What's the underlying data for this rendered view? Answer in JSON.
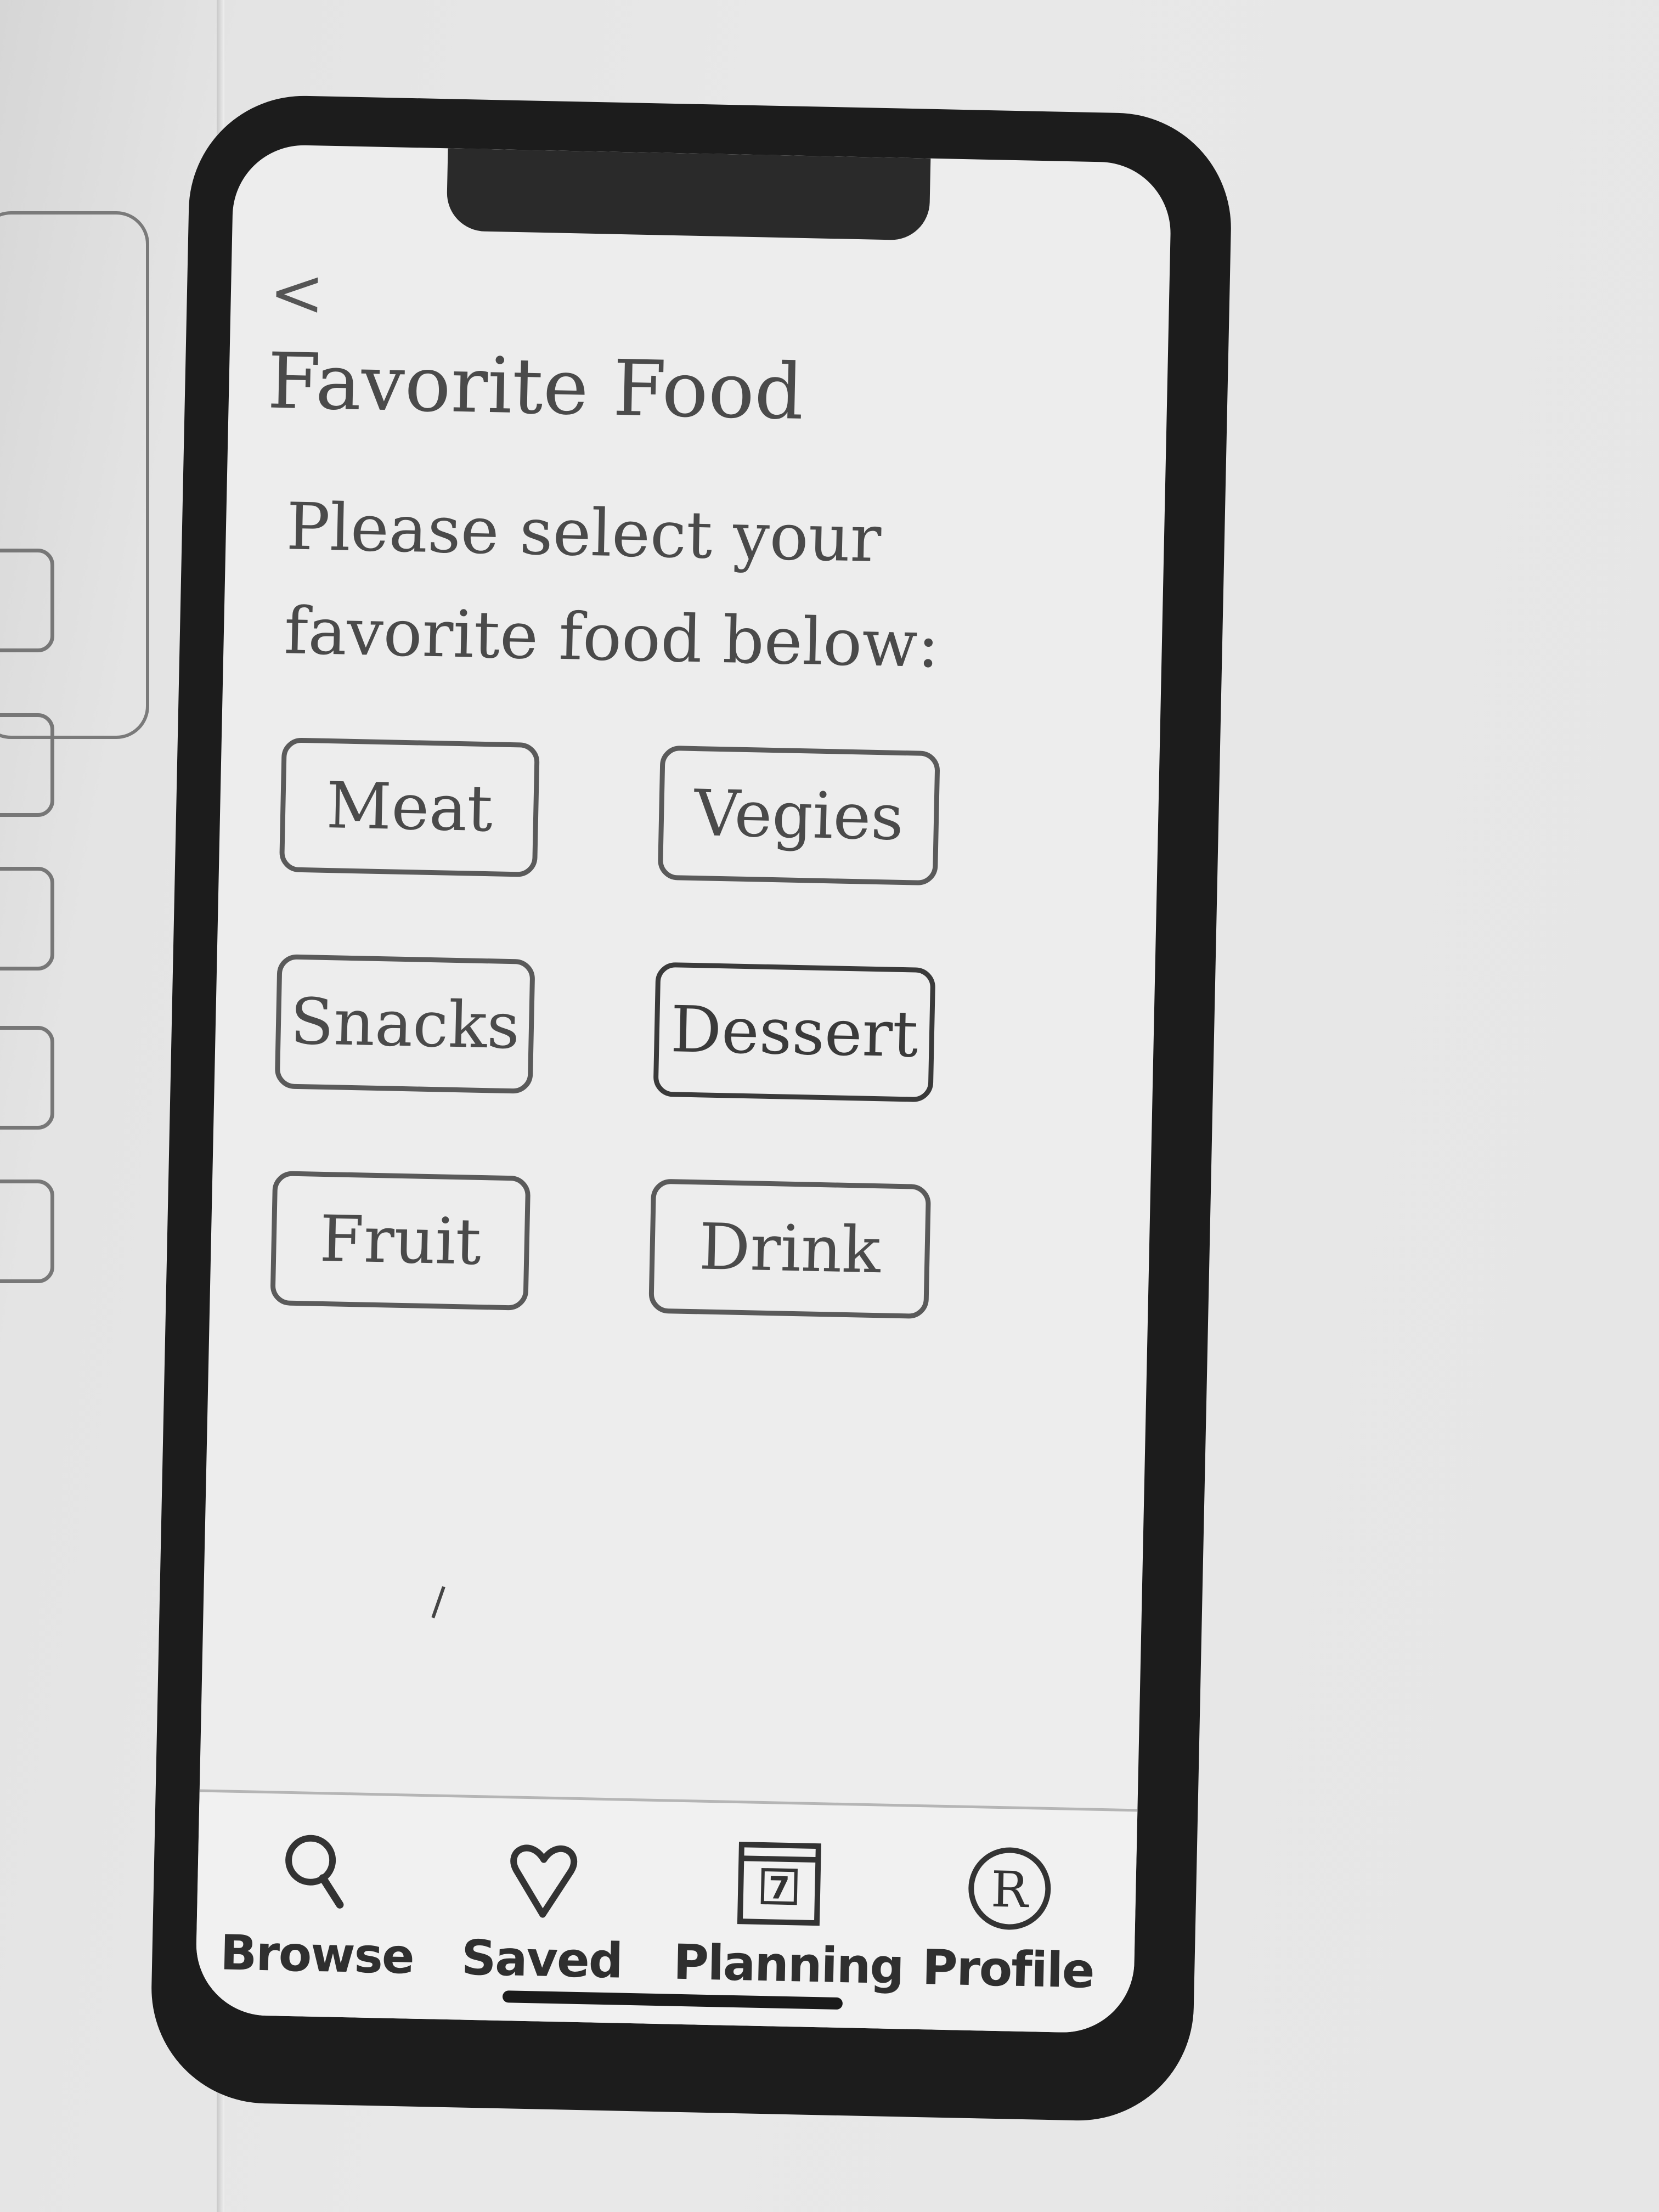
{
  "screen": {
    "back_glyph": "<",
    "title": "Favorite Food",
    "subtitle": "Please select your favorite food below:"
  },
  "food_options": [
    {
      "label": "Meat"
    },
    {
      "label": "Vegies"
    },
    {
      "label": "Snacks"
    },
    {
      "label": "Dessert"
    },
    {
      "label": "Fruit"
    },
    {
      "label": "Drink"
    }
  ],
  "tabbar": {
    "tabs": [
      {
        "label": "Browse",
        "icon": "search-icon"
      },
      {
        "label": "Saved",
        "icon": "heart-icon"
      },
      {
        "label": "Planning",
        "icon": "calendar-icon",
        "icon_text": "7"
      },
      {
        "label": "Profile",
        "icon": "profile-icon",
        "icon_text": "R"
      }
    ]
  }
}
